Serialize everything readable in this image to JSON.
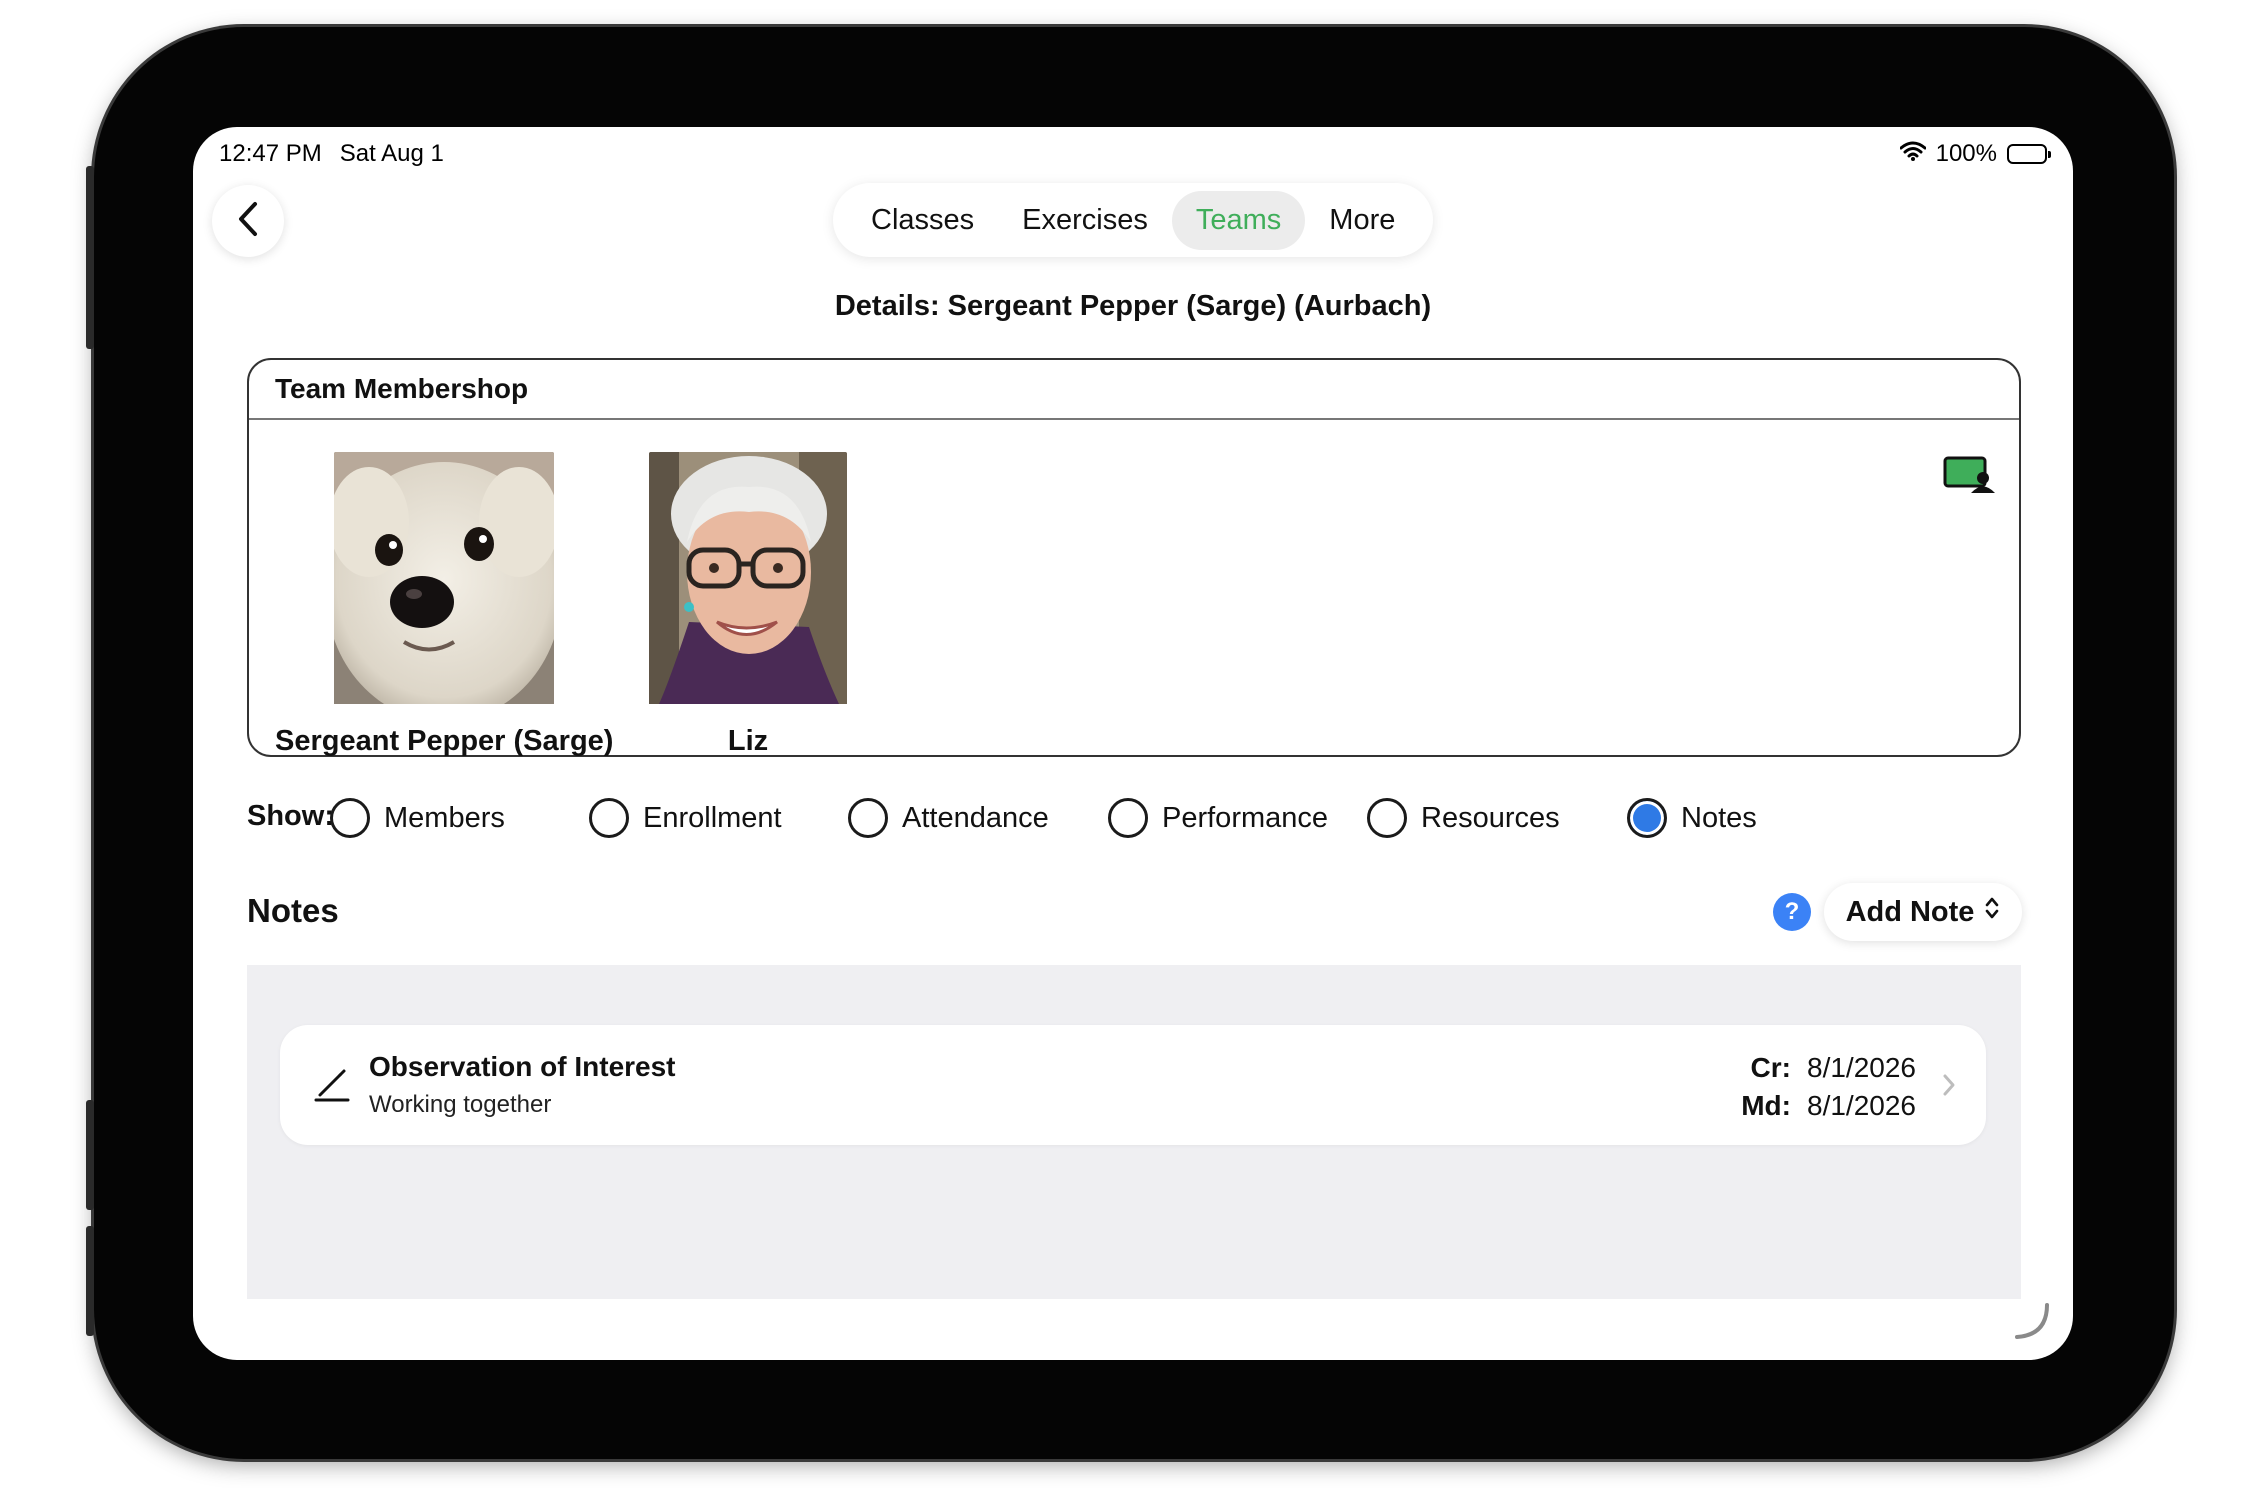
{
  "status_bar": {
    "time": "12:47 PM",
    "date": "Sat Aug 1",
    "battery": "100%"
  },
  "nav": {
    "back_icon": "chevron-left-icon",
    "tabs": [
      {
        "label": "Classes",
        "active": false
      },
      {
        "label": "Exercises",
        "active": false
      },
      {
        "label": "Teams",
        "active": true
      },
      {
        "label": "More",
        "active": false
      }
    ],
    "active_color": "#3fae5a"
  },
  "page": {
    "title": "Details: Sergeant Pepper (Sarge) (Aurbach)"
  },
  "team_card": {
    "header": "Team Membershop",
    "members": [
      {
        "name": "Sergeant Pepper (Sarge)",
        "photo": "dog-photo"
      },
      {
        "name": "Liz",
        "photo": "person-photo"
      }
    ],
    "icon": "person-card-icon"
  },
  "show": {
    "label": "Show:",
    "options": [
      {
        "label": "Members",
        "selected": false
      },
      {
        "label": "Enrollment",
        "selected": false
      },
      {
        "label": "Attendance",
        "selected": false
      },
      {
        "label": "Performance",
        "selected": false
      },
      {
        "label": "Resources",
        "selected": false
      },
      {
        "label": "Notes",
        "selected": true
      }
    ],
    "selected_color": "#2f7ae5"
  },
  "notes": {
    "title": "Notes",
    "help_label": "?",
    "add_label": "Add Note",
    "items": [
      {
        "title": "Observation of Interest",
        "subtitle": "Working together",
        "created_label": "Cr:",
        "created": "8/1/2026",
        "modified_label": "Md:",
        "modified": "8/1/2026"
      }
    ]
  }
}
